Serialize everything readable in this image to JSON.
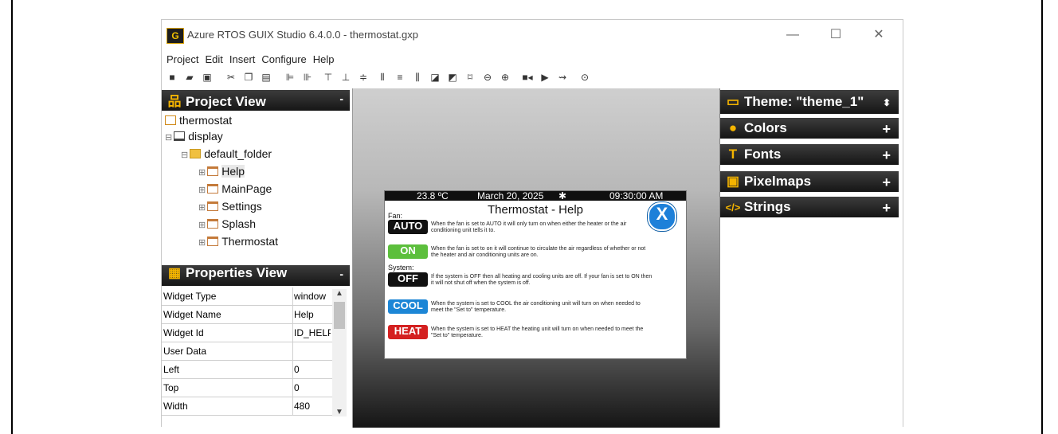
{
  "window": {
    "title": "Azure RTOS GUIX Studio 6.4.0.0 - thermostat.gxp",
    "logo_text": "G",
    "controls": [
      "—",
      "☐",
      "✕"
    ]
  },
  "menu": [
    "Project",
    "Edit",
    "Insert",
    "Configure",
    "Help"
  ],
  "toolbar_icons": [
    "new-icon",
    "open-icon",
    "save-icon",
    "cut-icon",
    "copy-icon",
    "paste-icon",
    "align-left-icon",
    "align-right-icon",
    "align-top-icon",
    "align-bottom-icon",
    "align-center-icon",
    "space-horiz-icon",
    "space-vert-icon",
    "equal-width-icon",
    "move-front-icon",
    "move-back-icon",
    "size-to-fit-icon",
    "zoom-out-icon",
    "zoom-in-icon",
    "record-icon",
    "run-icon",
    "macro-icon",
    "about-icon"
  ],
  "project_view": {
    "title": "Project View",
    "minimize": "-",
    "tree": [
      {
        "label": "thermostat"
      },
      {
        "label": "display"
      },
      {
        "label": "default_folder"
      },
      {
        "label": "Help"
      },
      {
        "label": "MainPage"
      },
      {
        "label": "Settings"
      },
      {
        "label": "Splash"
      },
      {
        "label": "Thermostat"
      }
    ]
  },
  "properties_view": {
    "title": "Properties View",
    "minimize": "-",
    "rows": [
      {
        "key": "Widget Type",
        "value": "window"
      },
      {
        "key": "Widget Name",
        "value": "Help"
      },
      {
        "key": "Widget Id",
        "value": "ID_HELP"
      },
      {
        "key": "User Data",
        "value": ""
      },
      {
        "key": "Left",
        "value": "0"
      },
      {
        "key": "Top",
        "value": "0"
      },
      {
        "key": "Width",
        "value": "480"
      }
    ]
  },
  "theme": {
    "title": "Theme: \"theme_1\"",
    "sections": [
      {
        "label": "Colors",
        "action": "+"
      },
      {
        "label": "Fonts",
        "action": "+"
      },
      {
        "label": "Pixelmaps",
        "action": "+"
      },
      {
        "label": "Strings",
        "action": "+"
      }
    ]
  },
  "preview": {
    "temperature": "23.8 ºC",
    "date": "March 20, 2025",
    "time": "09:30:00 AM",
    "title": "Thermostat - Help",
    "close_label": "X",
    "fan_label": "Fan:",
    "system_label": "System:",
    "items": [
      {
        "label": "AUTO",
        "color": "#111111",
        "text": "When the fan is set to AUTO it will only turn on when either the heater or the air conditioning unit tells it to."
      },
      {
        "label": "ON",
        "color": "#5cbf3c",
        "text": "When the fan is set to on it will continue to circulate the air regardless of whether or not the heater and air conditioning units are on."
      },
      {
        "label": "OFF",
        "color": "#111111",
        "text": "If the system is OFF then all heating and cooling units are off. If your fan is set to ON then it will not shut off when the system is off."
      },
      {
        "label": "COOL",
        "color": "#1c86d6",
        "text": "When the system is set to COOL the air conditioning unit will turn on when needed to meet the \"Set to\" temperature."
      },
      {
        "label": "HEAT",
        "color": "#d42020",
        "text": "When the system is set to HEAT the heating unit will turn on when needed to meet the \"Set to\" temperature."
      }
    ]
  }
}
